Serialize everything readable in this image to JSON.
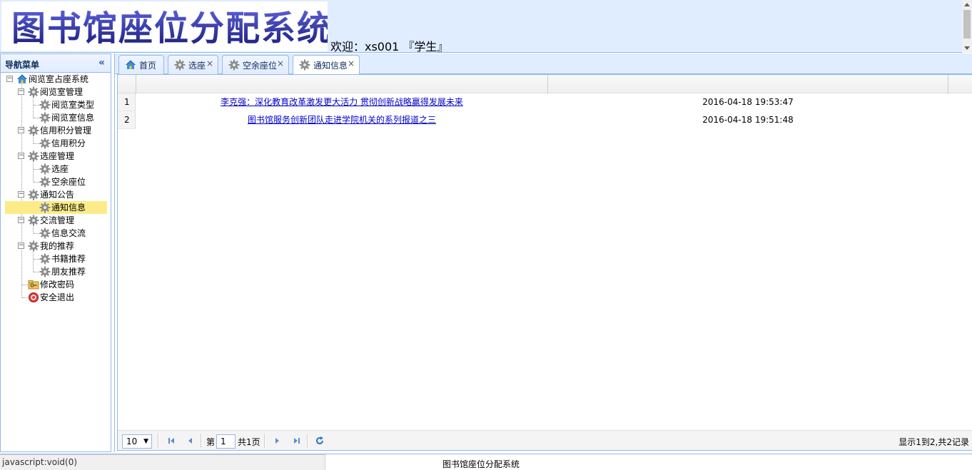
{
  "header": {
    "logo_text": "图书馆座位分配系统",
    "welcome": "欢迎：xs001 『学生』"
  },
  "west": {
    "title": "导航菜单",
    "collapse_glyph": "«",
    "tree": {
      "root": "阅览室占座系统",
      "groups": [
        {
          "label": "阅览室管理",
          "items": [
            "阅览室类型",
            "阅览室信息"
          ]
        },
        {
          "label": "信用积分管理",
          "items": [
            "信用积分"
          ]
        },
        {
          "label": "选座管理",
          "items": [
            "选座",
            "空余座位"
          ]
        },
        {
          "label": "通知公告",
          "items": [
            "通知信息"
          ]
        },
        {
          "label": "交流管理",
          "items": [
            "信息交流"
          ]
        },
        {
          "label": "我的推荐",
          "items": [
            "书籍推荐",
            "朋友推荐"
          ]
        }
      ],
      "change_password": "修改密码",
      "logout": "安全退出",
      "selected": "通知信息"
    }
  },
  "tabs": [
    {
      "label": "首页",
      "icon": "home-icon",
      "closable": false
    },
    {
      "label": "选座",
      "icon": "gear-icon",
      "closable": true
    },
    {
      "label": "空余座位",
      "icon": "gear-icon",
      "closable": true
    },
    {
      "label": "通知信息",
      "icon": "gear-icon",
      "closable": true,
      "active": true
    }
  ],
  "close_glyph": "×",
  "grid": {
    "rows": [
      {
        "num": "1",
        "title": "李克强：深化教育改革激发更大活力 贯彻创新战略赢得发展未来",
        "time": "2016-04-18 19:53:47"
      },
      {
        "num": "2",
        "title": "图书馆服务创新团队走进学院机关的系列报道之三",
        "time": "2016-04-18 19:51:48"
      }
    ]
  },
  "pager": {
    "page_size": "10",
    "page_prefix": "第",
    "page_value": "1",
    "page_total": "共1页",
    "info": "显示1到2,共2记录"
  },
  "statusbar": {
    "url": "javascript:void(0)",
    "footer": "图书馆座位分配系统"
  },
  "colors": {
    "panel_bg": "#e0ecff",
    "border": "#95b8e7",
    "selected_bg": "#fbec88",
    "link": "#0000cc"
  }
}
